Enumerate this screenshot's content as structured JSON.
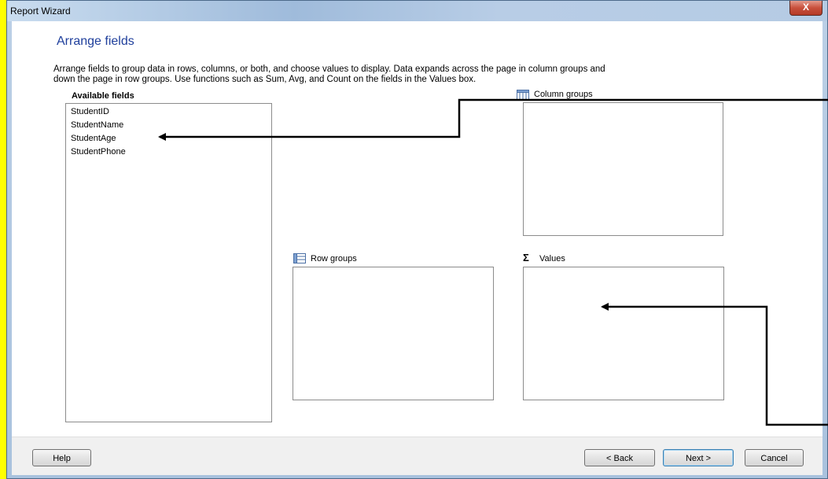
{
  "window": {
    "title": "Report Wizard",
    "close_glyph": "X"
  },
  "page": {
    "heading": "Arrange fields",
    "description_line1": "Arrange fields to group data in rows, columns, or both, and choose values to display. Data expands across the page in column groups and",
    "description_line2": "down the page in row groups.  Use functions such as Sum, Avg, and Count on the fields in the Values box."
  },
  "available_fields": {
    "label": "Available fields",
    "items": [
      "StudentID",
      "StudentName",
      "StudentAge",
      "StudentPhone"
    ]
  },
  "column_groups": {
    "label": "Column groups",
    "icon": "table-columns-icon"
  },
  "row_groups": {
    "label": "Row groups",
    "icon": "table-rows-icon"
  },
  "values": {
    "label": "Values",
    "icon": "sigma-icon",
    "glyph": "Σ"
  },
  "buttons": {
    "help": "Help",
    "back": "< Back",
    "next": "Next >",
    "cancel": "Cancel"
  },
  "colors": {
    "background": "#ffff00",
    "heading": "#1f3f9c",
    "close_button": "#c8503c"
  }
}
